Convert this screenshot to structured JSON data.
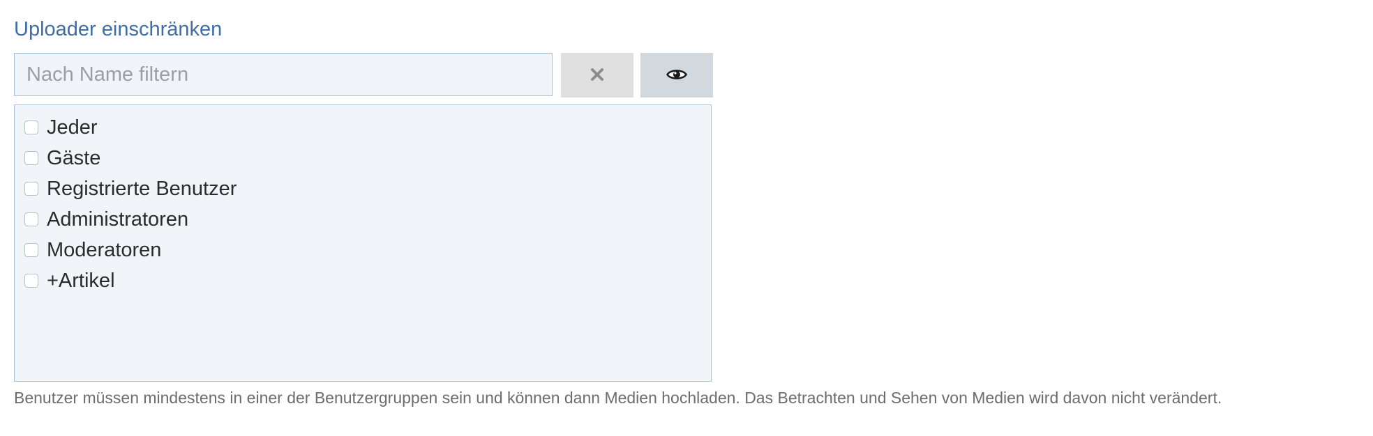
{
  "section": {
    "title": "Uploader einschränken"
  },
  "filter": {
    "placeholder": "Nach Name filtern",
    "value": ""
  },
  "buttons": {
    "clear_icon": "close-x-icon",
    "show_icon": "eye-icon"
  },
  "groups": [
    {
      "label": "Jeder",
      "checked": false
    },
    {
      "label": "Gäste",
      "checked": false
    },
    {
      "label": "Registrierte Benutzer",
      "checked": false
    },
    {
      "label": "Administratoren",
      "checked": false
    },
    {
      "label": "Moderatoren",
      "checked": false
    },
    {
      "label": "+Artikel",
      "checked": false
    }
  ],
  "help_text": "Benutzer müssen mindestens in einer der Benutzergruppen sein und können dann Medien hochladen. Das Betrachten und Sehen von Medien wird davon nicht verändert.",
  "colors": {
    "title": "#3f6ea6",
    "field_background": "#f1f5fa",
    "field_border": "#a9c1dc",
    "clear_button": "#e0e0e0",
    "show_button": "#d2d9de"
  }
}
